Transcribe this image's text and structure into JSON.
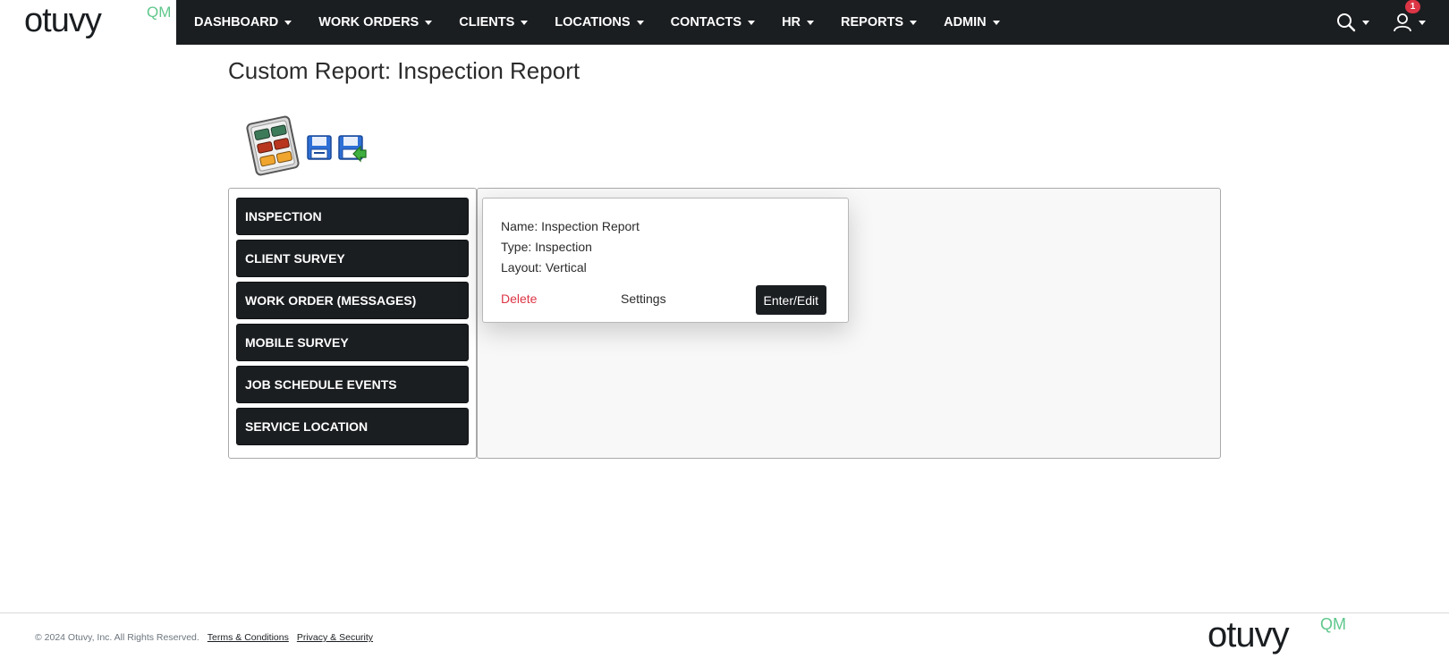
{
  "brand": {
    "logo_text": "otuvy",
    "logo_suffix": "QM",
    "accent_color": "#5fc78c",
    "nav_bg": "#1b1e21"
  },
  "nav": {
    "items": [
      {
        "label": "DASHBOARD"
      },
      {
        "label": "WORK ORDERS"
      },
      {
        "label": "CLIENTS"
      },
      {
        "label": "LOCATIONS"
      },
      {
        "label": "CONTACTS"
      },
      {
        "label": "HR"
      },
      {
        "label": "REPORTS"
      },
      {
        "label": "ADMIN"
      }
    ],
    "search_icon": "search-icon",
    "user_icon": "user-icon",
    "notification_count": "1"
  },
  "page": {
    "title": "Custom Report: Inspection Report"
  },
  "toolbar": {
    "report_icon": "report-grid-icon",
    "save_icon": "floppy-disk-icon",
    "save_as_icon": "floppy-disk-export-icon"
  },
  "report_types": [
    {
      "label": "INSPECTION"
    },
    {
      "label": "CLIENT SURVEY"
    },
    {
      "label": "WORK ORDER (MESSAGES)"
    },
    {
      "label": "MOBILE SURVEY"
    },
    {
      "label": "JOB SCHEDULE EVENTS"
    },
    {
      "label": "SERVICE LOCATION"
    }
  ],
  "report_card": {
    "name": "Name: Inspection Report",
    "type": "Type: Inspection",
    "layout": "Layout: Vertical",
    "delete_label": "Delete",
    "settings_label": "Settings",
    "enter_label": "Enter/Edit"
  },
  "footer": {
    "copyright": "© 2024 Otuvy, Inc. All Rights Reserved.",
    "terms_label": "Terms & Conditions",
    "privacy_label": "Privacy & Security"
  }
}
